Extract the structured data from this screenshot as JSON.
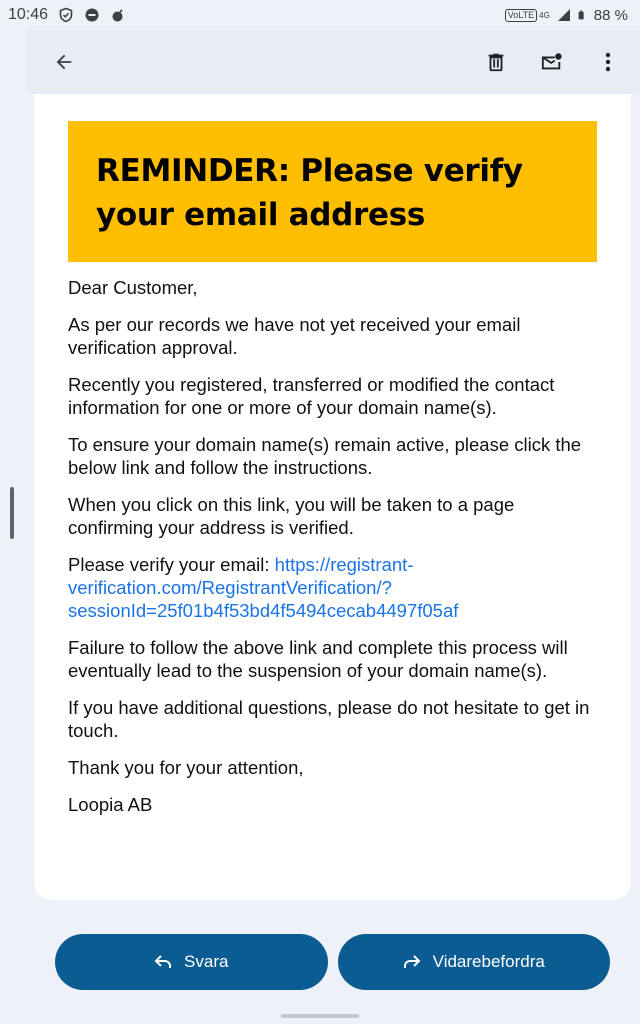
{
  "status_bar": {
    "time": "10:46",
    "network_badge": "VoLTE",
    "network_type": "4G",
    "battery": "88 %"
  },
  "toolbar": {
    "icons": [
      "back-arrow-icon",
      "delete-icon",
      "mark-unread-icon",
      "more-vert-icon"
    ]
  },
  "email": {
    "banner_title": "REMINDER: Please verify your email address",
    "greeting": "Dear Customer,",
    "p1": "As per our records we have not yet received your email verification approval.",
    "p2": "Recently you registered, transferred or modified the contact information for one or more of your domain name(s).",
    "p3": "To ensure your domain name(s) remain active, please click the below link and follow the instructions.",
    "p4": "When you click on this link, you will be taken to a page confirming your address is verified.",
    "verify_prefix": "Please verify your email: ",
    "verify_link": "https://registrant-verification.com/RegistrantVerification/?sessionId=25f01b4f53bd4f5494cecab4497f05af",
    "p6": "Failure to follow the above link and complete this process will eventually lead to the suspension of your domain name(s).",
    "p7": "If you have additional questions, please do not hesitate to get in touch.",
    "closing": "Thank you for your attention,",
    "signature": "Loopia AB"
  },
  "actions": {
    "reply_label": "Svara",
    "forward_label": "Vidarebefordra"
  },
  "colors": {
    "banner": "#ffbf00",
    "link": "#1a73e8",
    "button": "#0b5c93"
  }
}
